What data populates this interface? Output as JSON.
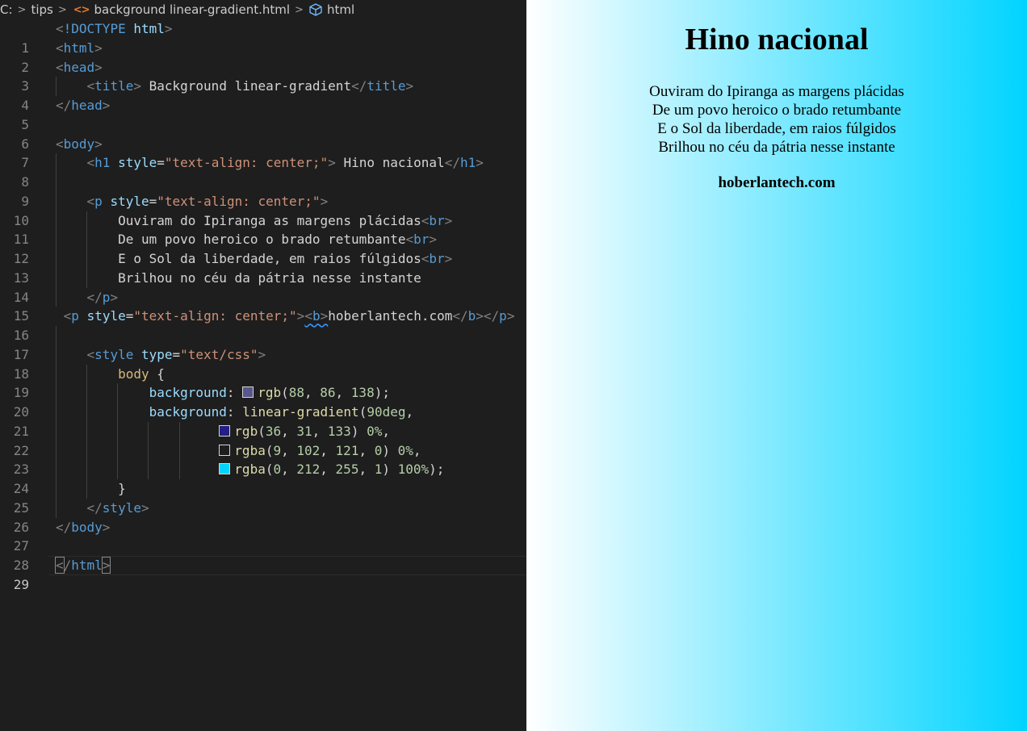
{
  "breadcrumb": {
    "drive": "C:",
    "folder": "tips",
    "file_icon": "html-file-icon",
    "file": "background linear-gradient.html",
    "symbol_icon": "cube-icon",
    "symbol": "html"
  },
  "editor": {
    "line_numbers": [
      "1",
      "2",
      "3",
      "4",
      "5",
      "6",
      "7",
      "8",
      "9",
      "10",
      "11",
      "12",
      "13",
      "14",
      "15",
      "16",
      "17",
      "18",
      "19",
      "20",
      "21",
      "22",
      "23",
      "24",
      "25",
      "26",
      "27",
      "28",
      "29"
    ],
    "current_line": "29",
    "colors": {
      "tag": "#569cd6",
      "attribute": "#9cdcfe",
      "string": "#ce9178",
      "number": "#b5cea8",
      "function": "#dcdcaa",
      "selector": "#d7ba7d"
    },
    "swatches": {
      "s20": "rgb(88, 86, 138)",
      "s22": "rgb(36, 31, 133)",
      "s23": "rgba(9, 102, 121, 0)",
      "s24": "rgba(0, 212, 255, 1)"
    },
    "tokens": {
      "doctype": "!DOCTYPE",
      "html": "html",
      "head": "head",
      "title": "title",
      "title_text": " Background linear-gradient",
      "body": "body",
      "h1": "h1",
      "p": "p",
      "b": "b",
      "br": "br",
      "style": "style",
      "style_attr": "style",
      "type_attr": "type",
      "center_value": "\"text-align: center;\"",
      "css_type_value": "\"text/css\"",
      "h1_text": " Hino nacional",
      "lyric1": "Ouviram do Ipiranga as margens plácidas",
      "lyric2": "De um povo heroico o brado retumbante",
      "lyric3": "E o Sol da liberdade, em raios fúlgidos",
      "lyric4": "Brilhou no céu da pátria nesse instante",
      "site": "hoberlantech.com",
      "selector_body": "body",
      "open_brace": " {",
      "close_brace": "}",
      "prop_background": "background",
      "fn_rgb": "rgb",
      "fn_rgba": "rgba",
      "fn_linear_gradient": "linear-gradient",
      "n88": "88",
      "n86": "86",
      "n138": "138",
      "n90deg": "90deg",
      "n36": "36",
      "n31": "31",
      "n133": "133",
      "n0pct": "0%",
      "n9": "9",
      "n102": "102",
      "n121": "121",
      "n0": "0",
      "n212": "212",
      "n255": "255",
      "n1": "1",
      "n100pct": "100%"
    }
  },
  "preview": {
    "background_gradient": "linear-gradient(90deg, rgb(36, 31, 133) 0%, rgba(9, 102, 121, 0) 0%, rgba(0, 212, 255, 1) 100%)",
    "heading": "Hino nacional",
    "lyrics": [
      "Ouviram do Ipiranga as margens plácidas",
      "De um povo heroico o brado retumbante",
      "E o Sol da liberdade, em raios fúlgidos",
      "Brilhou no céu da pátria nesse instante"
    ],
    "site": "hoberlantech.com"
  }
}
